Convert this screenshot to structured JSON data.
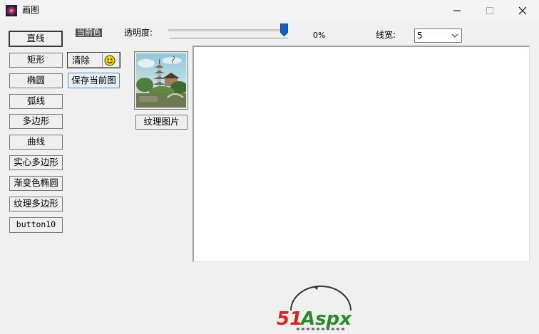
{
  "window": {
    "title": "画图",
    "icons": [
      "app-icon",
      "minimize-icon",
      "maximize-icon",
      "close-icon"
    ]
  },
  "shape_buttons": [
    {
      "label": "直线"
    },
    {
      "label": "矩形"
    },
    {
      "label": "椭圆"
    },
    {
      "label": "弧线"
    },
    {
      "label": "多边形"
    },
    {
      "label": "曲线"
    },
    {
      "label": "实心多边形"
    },
    {
      "label": "渐变色椭圆"
    },
    {
      "label": "纹理多边形"
    },
    {
      "label": "button10"
    }
  ],
  "color": {
    "label": "当前色",
    "value": "#555555"
  },
  "clear": {
    "label": "清除",
    "icon": "smiley-icon"
  },
  "save_button": {
    "label": "保存当前图"
  },
  "opacity": {
    "label": "透明度:",
    "value_text": "0%",
    "slider_fraction": 1.0
  },
  "line_width": {
    "label": "线宽:",
    "value": "5"
  },
  "texture": {
    "button_label": "纹理图片",
    "icon": "pagoda-landscape-picture"
  },
  "watermark": {
    "text": "51Aspx",
    "colors": {
      "51": "#e02020",
      "Aspx": "#2a8a2a"
    }
  }
}
